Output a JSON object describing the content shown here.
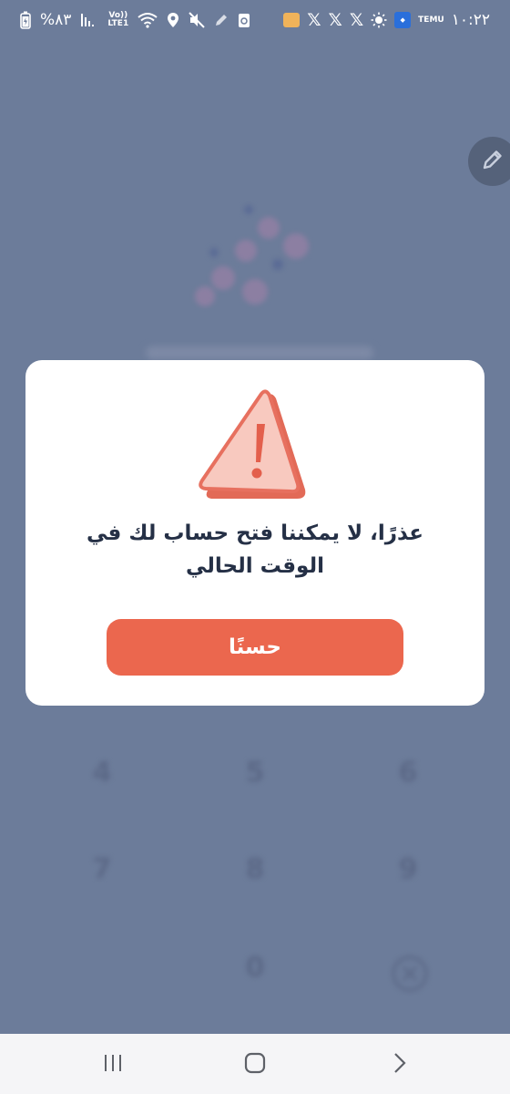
{
  "status_bar": {
    "battery_text": "%٨٣",
    "network_top": "Vo))",
    "network_bottom": "LTE1",
    "time": "١٠:٢٢",
    "temu_label": "TEMU"
  },
  "dialog": {
    "message": "عذرًا، لا يمكننا فتح حساب لك في الوقت الحالي",
    "ok_label": "حسنًا"
  },
  "keypad": {
    "keys": [
      "4",
      "5",
      "6",
      "7",
      "8",
      "9",
      "0"
    ]
  },
  "colors": {
    "overlay": "#6c7c9a",
    "button": "#eb674e",
    "warning_fill": "#f8c9bf",
    "warning_stroke": "#e7705f",
    "text": "#253046"
  }
}
